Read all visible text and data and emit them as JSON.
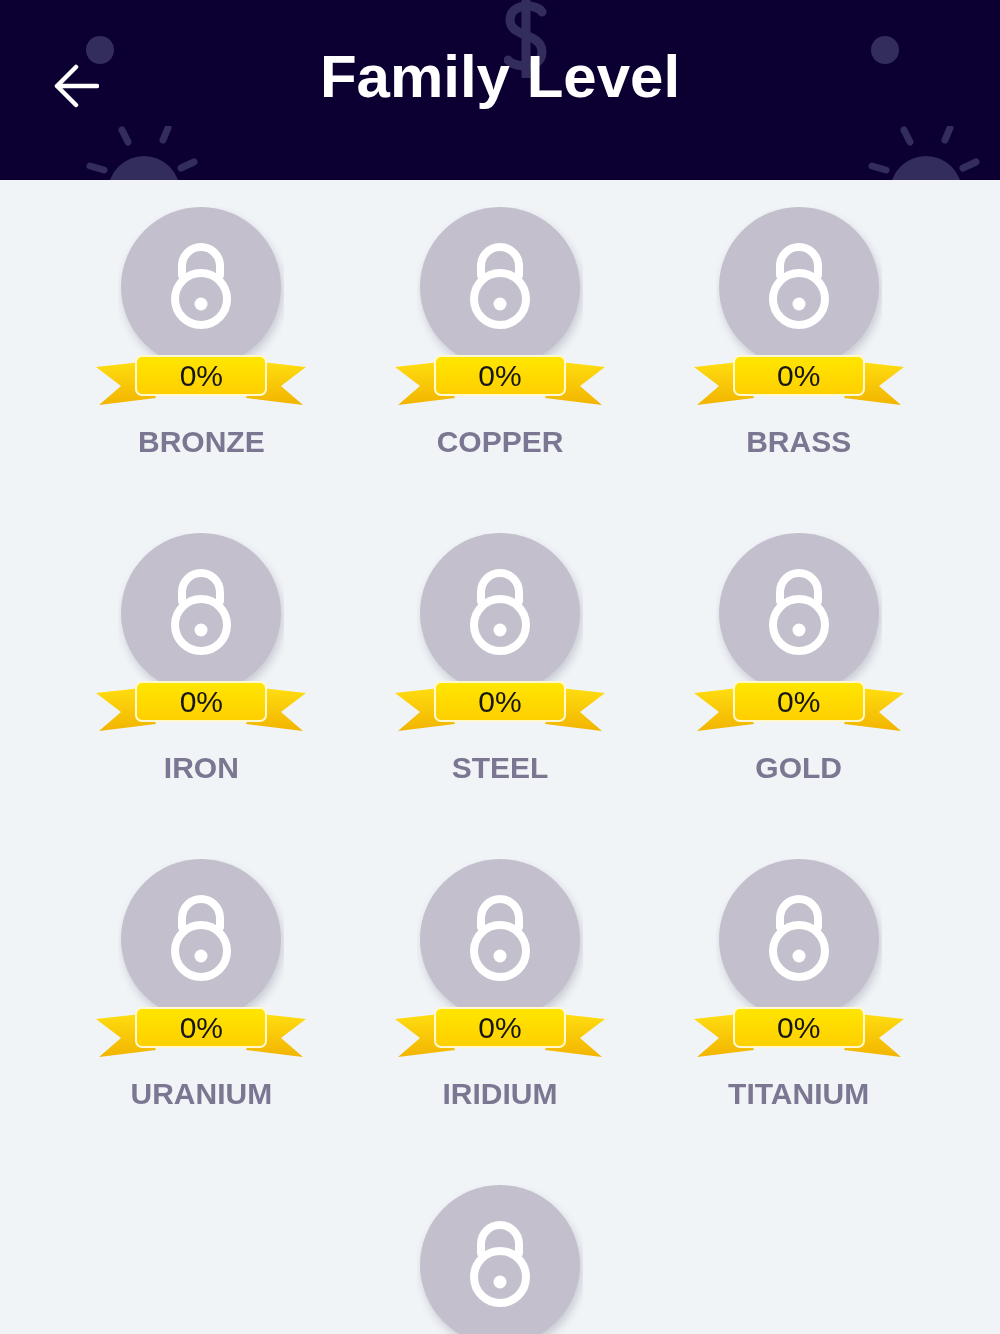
{
  "header": {
    "title": "Family Level"
  },
  "levels": [
    {
      "name": "BRONZE",
      "progress": "0%",
      "locked": true
    },
    {
      "name": "COPPER",
      "progress": "0%",
      "locked": true
    },
    {
      "name": "BRASS",
      "progress": "0%",
      "locked": true
    },
    {
      "name": "IRON",
      "progress": "0%",
      "locked": true
    },
    {
      "name": "STEEL",
      "progress": "0%",
      "locked": true
    },
    {
      "name": "GOLD",
      "progress": "0%",
      "locked": true
    },
    {
      "name": "URANIUM",
      "progress": "0%",
      "locked": true
    },
    {
      "name": "IRIDIUM",
      "progress": "0%",
      "locked": true
    },
    {
      "name": "TITANIUM",
      "progress": "0%",
      "locked": true
    },
    {
      "locked": true
    }
  ]
}
